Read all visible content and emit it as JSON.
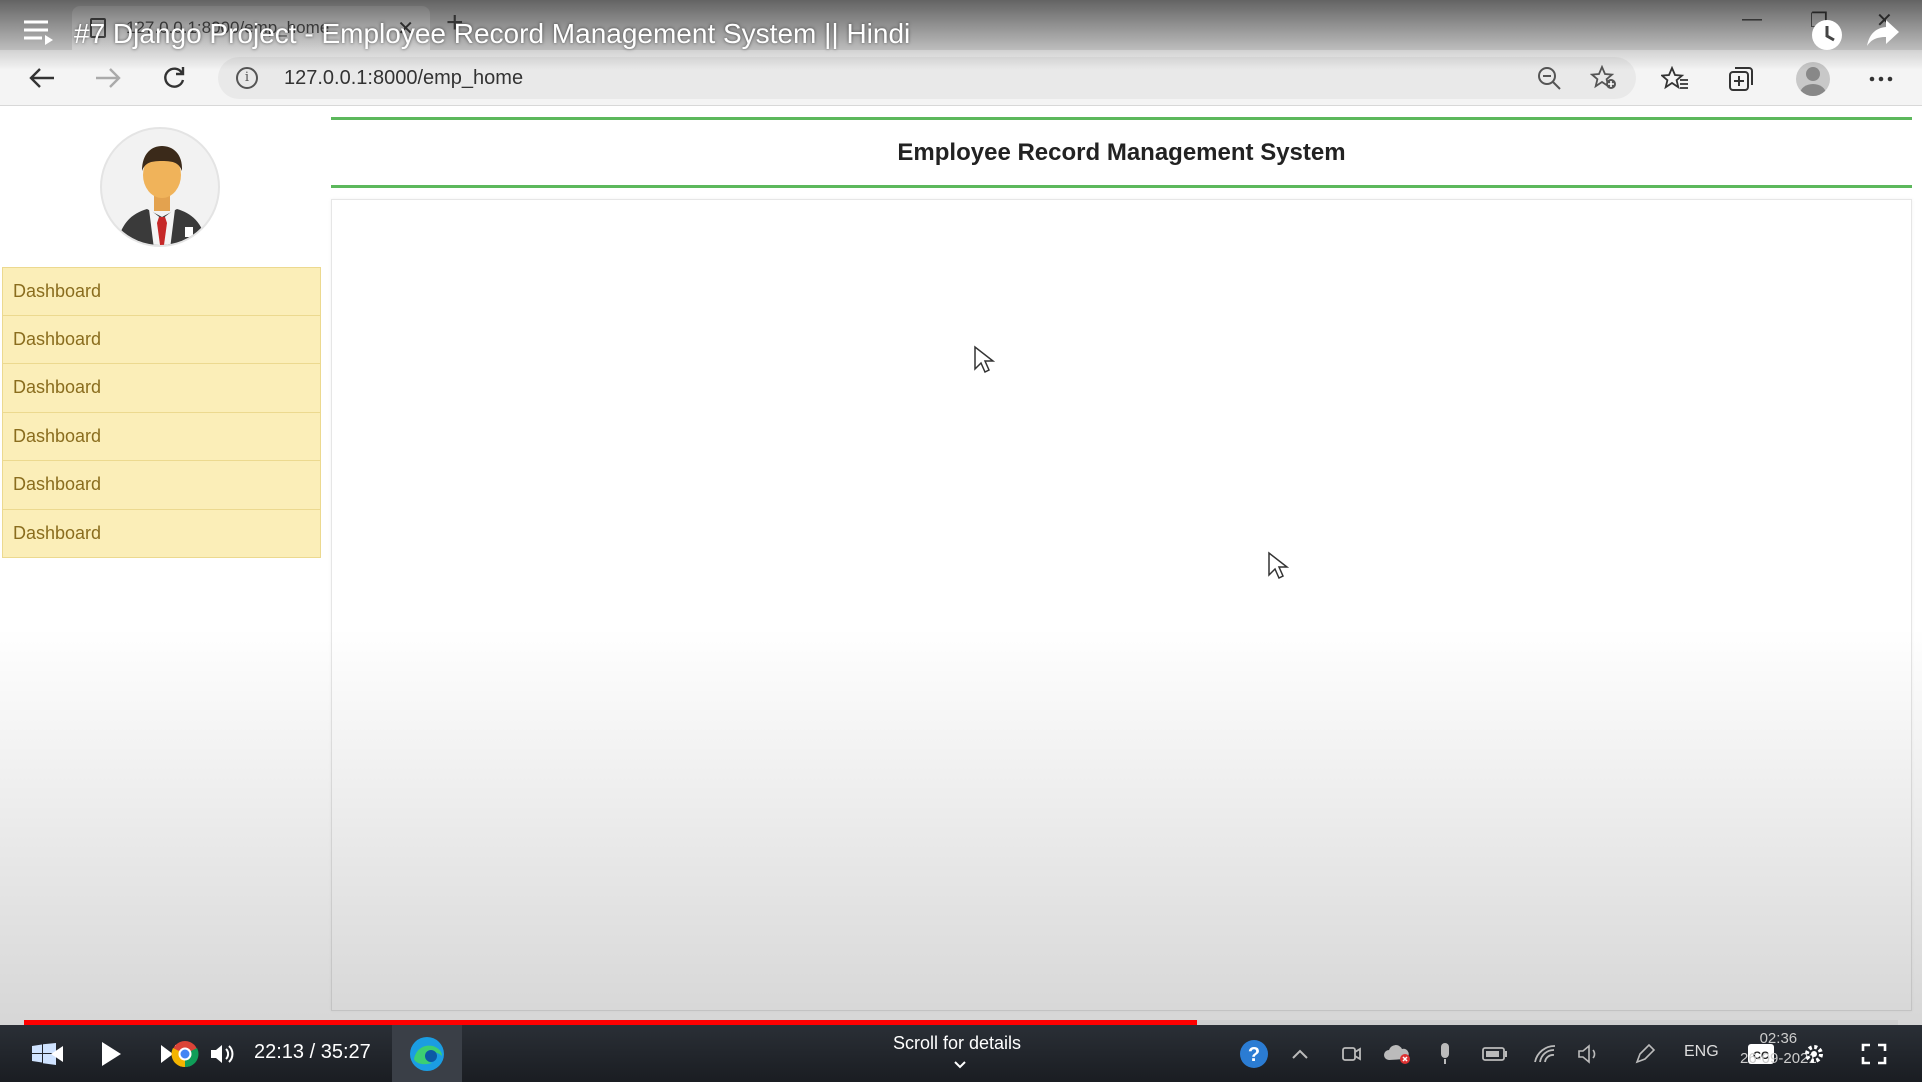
{
  "browser": {
    "tab_title": "127.0.0.1:8000/emp_home",
    "url": "127.0.0.1:8000/emp_home"
  },
  "youtube": {
    "video_title": "#7 Django Project - Employee Record Management System || Hindi",
    "time_current": "22:13",
    "time_total": "35:27",
    "time_display": "22:13 / 35:27",
    "progress_fraction": 0.626,
    "scroll_hint": "Scroll for details"
  },
  "page": {
    "header_title": "Employee Record Management System",
    "sidebar_items": [
      {
        "label": "Dashboard"
      },
      {
        "label": "Dashboard"
      },
      {
        "label": "Dashboard"
      },
      {
        "label": "Dashboard"
      },
      {
        "label": "Dashboard"
      },
      {
        "label": "Dashboard"
      }
    ]
  },
  "system_tray": {
    "language": "ENG",
    "time": "02:36",
    "date": "26-09-2021"
  },
  "colors": {
    "accent_green": "#5cb85c",
    "menu_bg": "#fbeeb8",
    "menu_text": "#8a6d1e",
    "progress_red": "#ff0000"
  }
}
